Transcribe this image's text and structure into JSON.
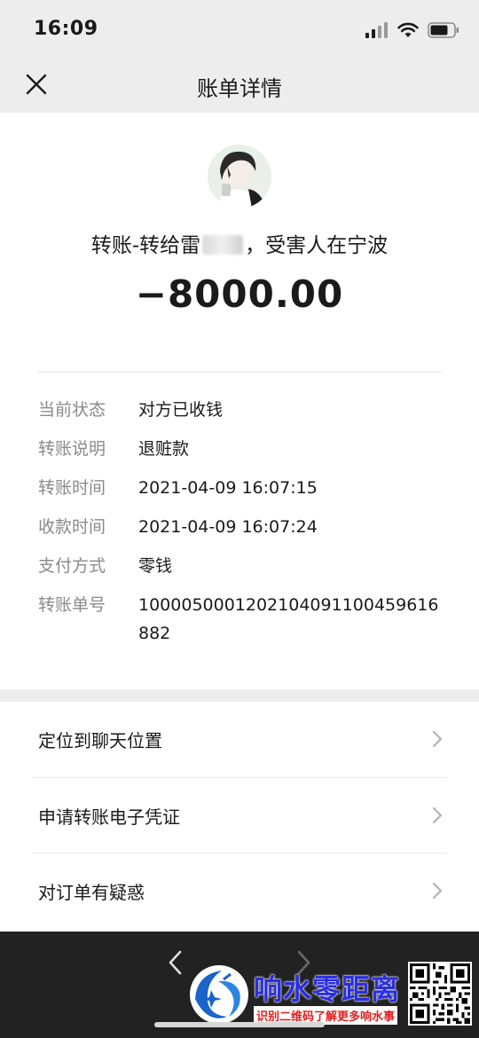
{
  "status_bar": {
    "time": "16:09"
  },
  "nav": {
    "title": "账单详情"
  },
  "transfer": {
    "title_prefix": "转账-转给雷",
    "title_suffix": "，受害人在宁波",
    "amount": "−8000.00"
  },
  "details": [
    {
      "label": "当前状态",
      "value": "对方已收钱"
    },
    {
      "label": "转账说明",
      "value": "退赃款"
    },
    {
      "label": "转账时间",
      "value": "2021-04-09 16:07:15"
    },
    {
      "label": "收款时间",
      "value": "2021-04-09 16:07:24"
    },
    {
      "label": "支付方式",
      "value": "零钱"
    },
    {
      "label": "转账单号",
      "value": "1000050001202104091100459616882"
    }
  ],
  "actions": [
    {
      "label": "定位到聊天位置"
    },
    {
      "label": "申请转账电子凭证"
    },
    {
      "label": "对订单有疑惑"
    }
  ],
  "watermark": {
    "title": "响水零距离",
    "subtitle": "识别二维码了解更多响水事"
  }
}
